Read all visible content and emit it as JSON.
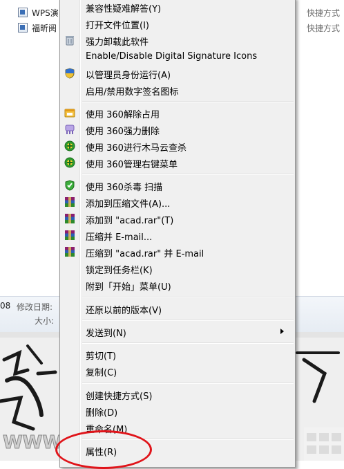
{
  "explorer": {
    "files": [
      {
        "name": "WPS演",
        "type": "快捷方式"
      },
      {
        "name": "福昕阅",
        "type": "快捷方式"
      }
    ],
    "details": {
      "left_value": "08",
      "modified_label": "修改日期:",
      "size_label": "大小:"
    }
  },
  "context_menu": {
    "items": [
      {
        "label": "兼容性疑难解答(Y)",
        "icon": null
      },
      {
        "label": "打开文件位置(I)",
        "icon": null
      },
      {
        "label": "强力卸载此软件",
        "icon": "trash-icon"
      },
      {
        "label": "Enable/Disable Digital Signature Icons",
        "icon": null
      },
      {
        "label": "以管理员身份运行(A)",
        "icon": "uac-shield-icon"
      },
      {
        "label": "启用/禁用数字签名图标",
        "icon": null
      },
      {
        "label": "使用 360解除占用",
        "icon": "360-unlock-icon"
      },
      {
        "label": "使用 360强力删除",
        "icon": "360-shred-icon"
      },
      {
        "label": "使用 360进行木马云查杀",
        "icon": "360-cloud-scan-icon"
      },
      {
        "label": "使用 360管理右键菜单",
        "icon": "360-menu-manager-icon"
      },
      {
        "label": "使用 360杀毒 扫描",
        "icon": "360-antivirus-icon"
      },
      {
        "label": "添加到压缩文件(A)...",
        "icon": "winrar-icon"
      },
      {
        "label": "添加到 \"acad.rar\"(T)",
        "icon": "winrar-icon"
      },
      {
        "label": "压缩并 E-mail...",
        "icon": "winrar-icon"
      },
      {
        "label": "压缩到 \"acad.rar\" 并 E-mail",
        "icon": "winrar-icon"
      },
      {
        "label": "锁定到任务栏(K)",
        "icon": null
      },
      {
        "label": "附到「开始」菜单(U)",
        "icon": null
      },
      {
        "label": "还原以前的版本(V)",
        "icon": null
      },
      {
        "label": "发送到(N)",
        "icon": null,
        "submenu": true
      },
      {
        "label": "剪切(T)",
        "icon": null
      },
      {
        "label": "复制(C)",
        "icon": null
      },
      {
        "label": "创建快捷方式(S)",
        "icon": null
      },
      {
        "label": "删除(D)",
        "icon": null
      },
      {
        "label": "重命名(M)",
        "icon": null
      },
      {
        "label": "属性(R)",
        "icon": null,
        "highlighted_by_annotation": true
      }
    ]
  },
  "colors": {
    "menu_background": "#f0f0f0",
    "annotation_red": "#e0141a",
    "green_360": "#2e9d2e"
  }
}
